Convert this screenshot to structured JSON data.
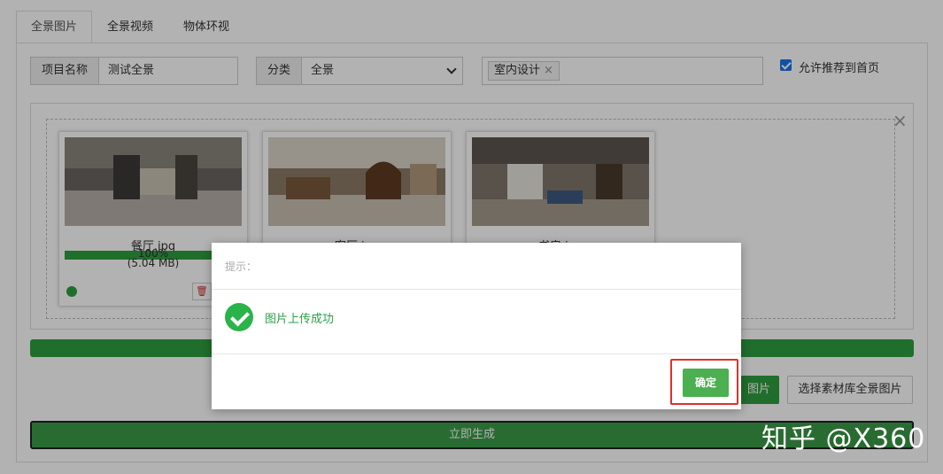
{
  "tabs": [
    {
      "label": "全景图片",
      "active": true
    },
    {
      "label": "全景视频",
      "active": false
    },
    {
      "label": "物体环视",
      "active": false
    }
  ],
  "form": {
    "project_label": "项目名称",
    "project_value": "测试全景",
    "category_label": "分类",
    "category_value": "全景",
    "tags": [
      {
        "label": "室内设计",
        "remove": "×"
      }
    ],
    "recommend_label": "允许推荐到首页",
    "recommend_checked": true
  },
  "upload": {
    "close": "×",
    "cards": [
      {
        "name": "餐厅.jpg",
        "progress_text": "100%",
        "size_text": "(5.04 MB)",
        "progress": 1.0
      },
      {
        "name": "客厅.jpg"
      },
      {
        "name": "书房.jpg"
      }
    ]
  },
  "buttons": {
    "upload_label": "图片",
    "library_label": "选择素材库全景图片",
    "generate_label": "立即生成"
  },
  "modal": {
    "title": "提示：",
    "message": "图片上传成功",
    "confirm_label": "确定"
  },
  "watermark": "知乎 @X360",
  "colors": {
    "accent_green": "#2e9e3e",
    "confirm_green": "#4caf50",
    "highlight_red": "#e0302a"
  }
}
